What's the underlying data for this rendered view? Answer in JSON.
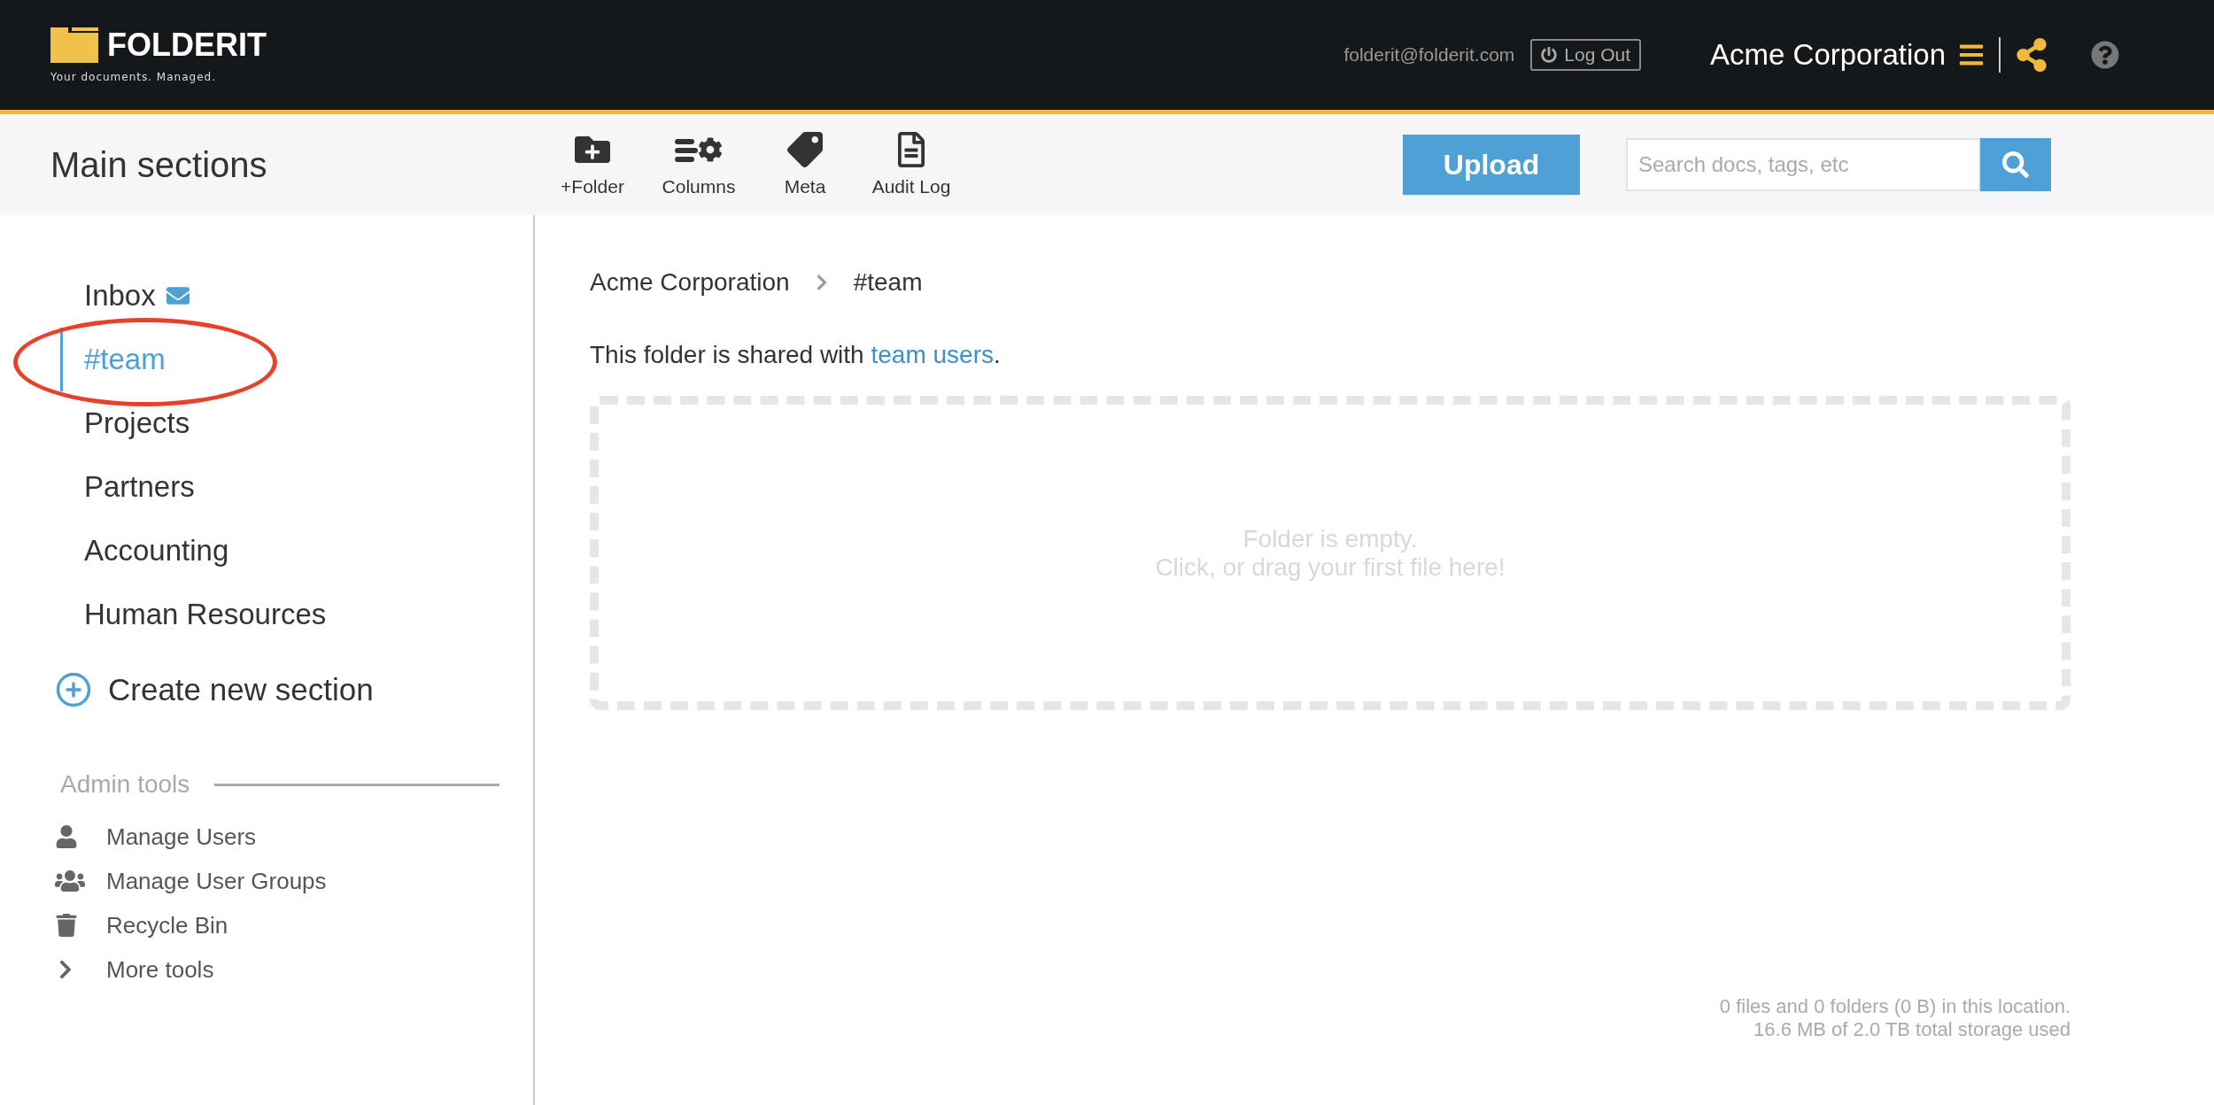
{
  "header": {
    "logo": {
      "name": "FOLDERIT",
      "tagline": "Your documents. Managed."
    },
    "email": "folderit@folderit.com",
    "logout": "Log Out",
    "company": "Acme Corporation"
  },
  "toolbar": {
    "title": "Main sections",
    "tools": [
      {
        "label": "+Folder",
        "kind": "folder"
      },
      {
        "label": "Columns",
        "kind": "columns"
      },
      {
        "label": "Meta",
        "kind": "meta"
      },
      {
        "label": "Audit Log",
        "kind": "log"
      }
    ],
    "upload": "Upload",
    "search": {
      "placeholder": "Search docs, tags, etc"
    }
  },
  "sidebar": {
    "items": [
      {
        "label": "Inbox",
        "kind": "inbox",
        "selected": false
      },
      {
        "label": "#team",
        "kind": "section",
        "selected": true
      },
      {
        "label": "Projects",
        "kind": "section",
        "selected": false
      },
      {
        "label": "Partners",
        "kind": "section",
        "selected": false
      },
      {
        "label": "Accounting",
        "kind": "section",
        "selected": false
      },
      {
        "label": "Human Resources",
        "kind": "section",
        "selected": false
      }
    ],
    "create": "Create new section",
    "admin": {
      "title": "Admin tools",
      "items": [
        {
          "label": "Manage Users",
          "kind": "user"
        },
        {
          "label": "Manage User Groups",
          "kind": "group"
        },
        {
          "label": "Recycle Bin",
          "kind": "bin"
        },
        {
          "label": "More tools",
          "kind": "more"
        }
      ]
    }
  },
  "main": {
    "breadcrumb": [
      "Acme Corporation",
      "#team"
    ],
    "shared": {
      "text": "This folder is shared with",
      "link": "team users",
      "end": "."
    },
    "dropzone": [
      "Folder is empty.",
      "Click, or drag your first file here!"
    ],
    "footer": [
      "0 files and 0 folders (0 B) in this location.",
      "16.6 MB of 2.0 TB total storage used"
    ]
  }
}
